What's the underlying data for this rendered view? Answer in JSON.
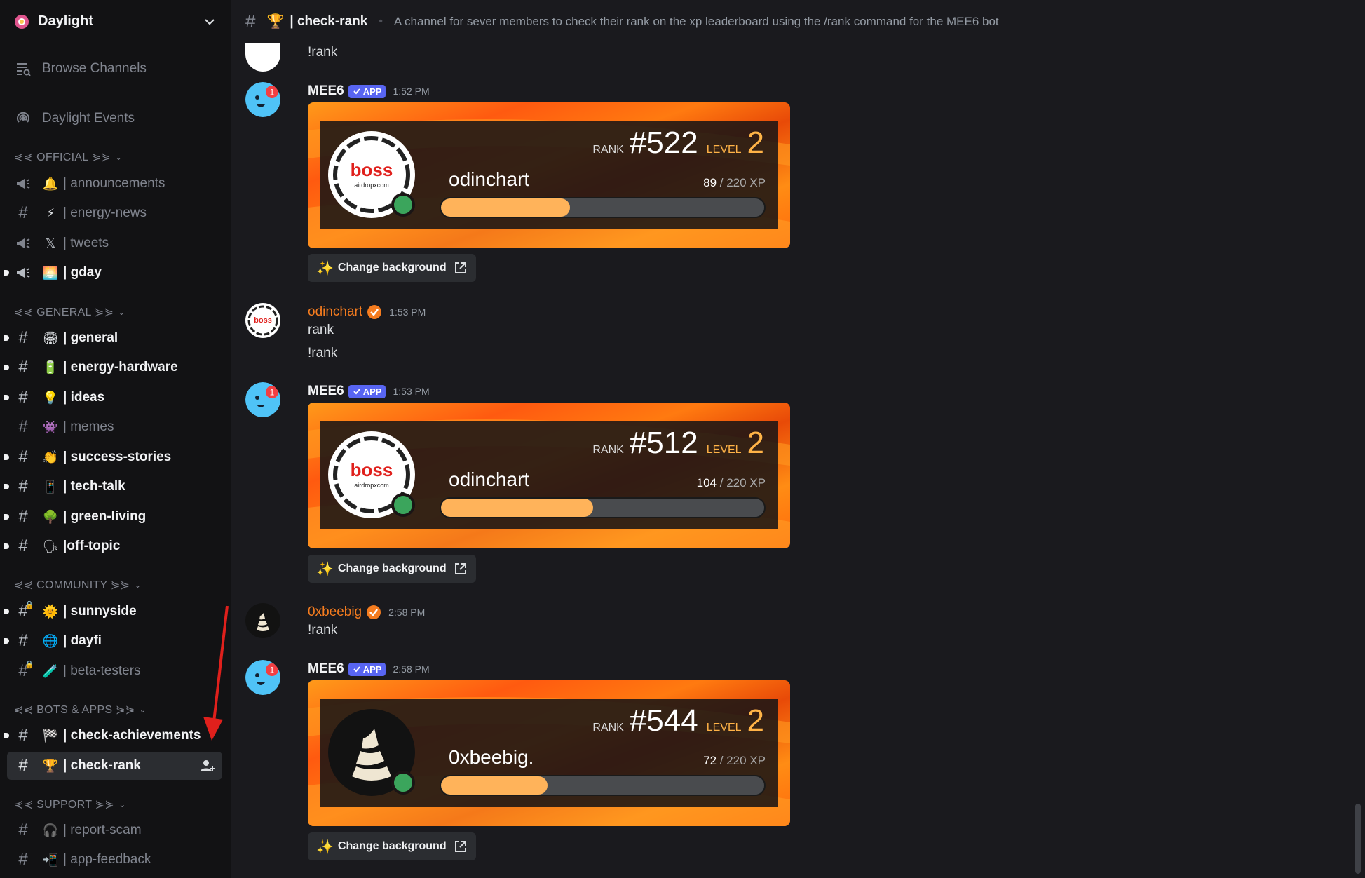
{
  "server": {
    "name": "Daylight"
  },
  "sidebar": {
    "browse_channels": "Browse Channels",
    "events": "Daylight Events",
    "categories": {
      "official": "⋞⋞ OFFICIAL ⋟⋟",
      "general": "⋞⋞ GENERAL ⋟⋟",
      "community": "⋞⋞ COMMUNITY ⋟⋟",
      "bots": "⋞⋞ BOTS & APPS ⋟⋟",
      "support": "⋞⋞ SUPPORT ⋟⋟"
    },
    "channels": {
      "announcements": {
        "emoji": "🔔",
        "label": "| announcements"
      },
      "energy_news": {
        "emoji": "⚡",
        "label": "| energy-news"
      },
      "tweets": {
        "emoji": "𝕏",
        "label": "| tweets"
      },
      "gday": {
        "emoji": "🌅",
        "label": "| gday"
      },
      "general": {
        "emoji": "🏟",
        "label": "| general"
      },
      "energy_hardware": {
        "emoji": "🔋",
        "label": "| energy-hardware"
      },
      "ideas": {
        "emoji": "💡",
        "label": "| ideas"
      },
      "memes": {
        "emoji": "👾",
        "label": "| memes"
      },
      "success_stories": {
        "emoji": "👏",
        "label": "| success-stories"
      },
      "tech_talk": {
        "emoji": "📱",
        "label": "| tech-talk"
      },
      "green_living": {
        "emoji": "🌳",
        "label": "| green-living"
      },
      "off_topic": {
        "emoji": "🗣",
        "label": "|off-topic"
      },
      "sunnyside": {
        "emoji": "🌞",
        "label": "| sunnyside"
      },
      "dayfi": {
        "emoji": "🌐",
        "label": "| dayfi"
      },
      "beta_testers": {
        "emoji": "🧪",
        "label": "| beta-testers"
      },
      "check_achievements": {
        "emoji": "🏁",
        "label": "| check-achievements"
      },
      "check_rank": {
        "emoji": "🏆",
        "label": "| check-rank"
      },
      "report_scam": {
        "emoji": "🎧",
        "label": "| report-scam"
      },
      "app_feedback": {
        "emoji": "📲",
        "label": "| app-feedback"
      }
    }
  },
  "topbar": {
    "emoji": "🏆",
    "channel": "| check-rank",
    "topic": "A channel for sever members to check their rank on the xp leaderboard using the /rank command for the MEE6 bot"
  },
  "messages": {
    "m0": {
      "text": "!rank"
    },
    "m1": {
      "author": "MEE6",
      "badge": "APP",
      "time": "1:52 PM",
      "card": {
        "rank_label": "RANK",
        "rank": "#522",
        "level_label": "LEVEL",
        "level": "2",
        "name": "odinchart",
        "xp_current": "89",
        "xp_total": "/ 220 XP",
        "progress": 0.4
      },
      "button": "Change background"
    },
    "m2": {
      "author": "odinchart",
      "time": "1:53 PM",
      "line1": "rank",
      "line2": "!rank"
    },
    "m3": {
      "author": "MEE6",
      "badge": "APP",
      "time": "1:53 PM",
      "card": {
        "rank_label": "RANK",
        "rank": "#512",
        "level_label": "LEVEL",
        "level": "2",
        "name": "odinchart",
        "xp_current": "104",
        "xp_total": "/ 220 XP",
        "progress": 0.47
      },
      "button": "Change background"
    },
    "m4": {
      "author": "0xbeebig",
      "time": "2:58 PM",
      "line1": "!rank"
    },
    "m5": {
      "author": "MEE6",
      "badge": "APP",
      "time": "2:58 PM",
      "card": {
        "rank_label": "RANK",
        "rank": "#544",
        "level_label": "LEVEL",
        "level": "2",
        "name": "0xbeebig.",
        "xp_current": "72",
        "xp_total": "/ 220 XP",
        "progress": 0.33
      },
      "button": "Change background"
    }
  },
  "avatars": {
    "boss_text": "boss",
    "boss_sub": "airdropxcom",
    "mee6_notif": "1"
  },
  "colors": {
    "accent": "#5865f2",
    "orange_user": "#f57c1f",
    "online": "#3ba55c",
    "xp_fill": "#ffb35a",
    "arrow": "#e0201c"
  }
}
